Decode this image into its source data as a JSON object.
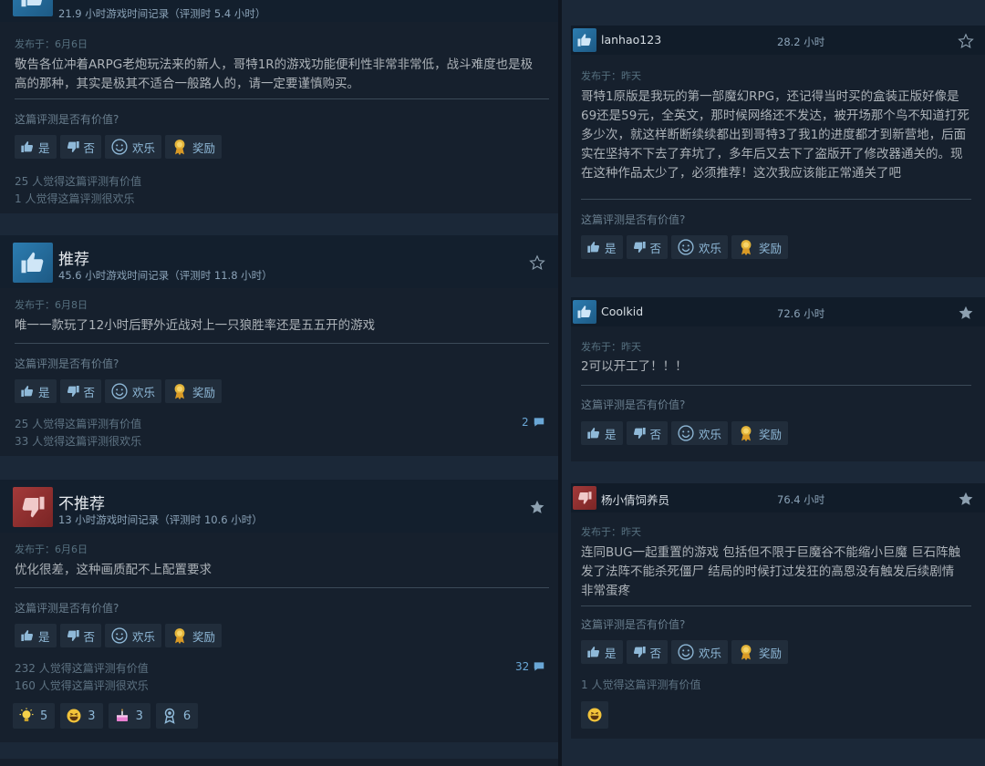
{
  "buttons": {
    "yes": "是",
    "no": "否",
    "funny": "欢乐",
    "award": "奖励"
  },
  "helpful_question": "这篇评测是否有价值?",
  "left_reviews": [
    {
      "verdict": "推荐",
      "hours": "21.9 小时游戏时间记录（评测时 5.4 小时）",
      "posted": "发布于：6月6日",
      "text": "敬告各位冲着ARPG老炮玩法来的新人，哥特1R的游戏功能便利性非常非常低，战斗难度也是极高的那种，其实是极其不适合一般路人的，请一定要谨慎购买。",
      "helpful": "25 人觉得这篇评测有价值",
      "funny": "1 人觉得这篇评测很欢乐"
    },
    {
      "verdict": "推荐",
      "hours": "45.6 小时游戏时间记录（评测时 11.8 小时）",
      "posted": "发布于：6月8日",
      "text": "唯一一款玩了12小时后野外近战对上一只狼胜率还是五五开的游戏",
      "helpful": "25 人觉得这篇评测有价值",
      "funny": "33 人觉得这篇评测很欢乐",
      "comments": "2"
    },
    {
      "verdict": "不推荐",
      "hours": "13 小时游戏时间记录（评测时 10.6 小时）",
      "posted": "发布于：6月6日",
      "text": "优化很差，这种画质配不上配置要求",
      "helpful": "232 人觉得这篇评测有价值",
      "funny": "160 人觉得这篇评测很欢乐",
      "comments": "32",
      "awards": [
        "5",
        "3",
        "3",
        "6"
      ]
    }
  ],
  "right_reviews": [
    {
      "user": "lanhao123",
      "hours": "28.2 小时",
      "posted": "发布于：昨天",
      "text": "哥特1原版是我玩的第一部魔幻RPG，还记得当时买的盒装正版好像是69还是59元，全英文，那时候网络还不发达，被开场那个鸟不知道打死多少次，就这样断断续续都出到哥特3了我1的进度都才到新营地，后面实在坚持不下去了弃坑了，多年后又去下了盗版开了修改器通关的。现在这种作品太少了，必须推荐！这次我应该能正常通关了吧"
    },
    {
      "user": "Coolkid",
      "hours": "72.6 小时",
      "posted": "发布于：昨天",
      "text": "2可以开工了！！！"
    },
    {
      "user": "杨小倩饲养员",
      "hours": "76.4 小时",
      "posted": "发布于：昨天",
      "text": "连同BUG一起重置的游戏 包括但不限于巨魔谷不能缩小巨魔 巨石阵触发了法阵不能杀死僵尸 结局的时候打过发狂的高恩没有触发后续剧情 非常蛋疼",
      "helpful": "1 人觉得这篇评测有价值"
    }
  ]
}
